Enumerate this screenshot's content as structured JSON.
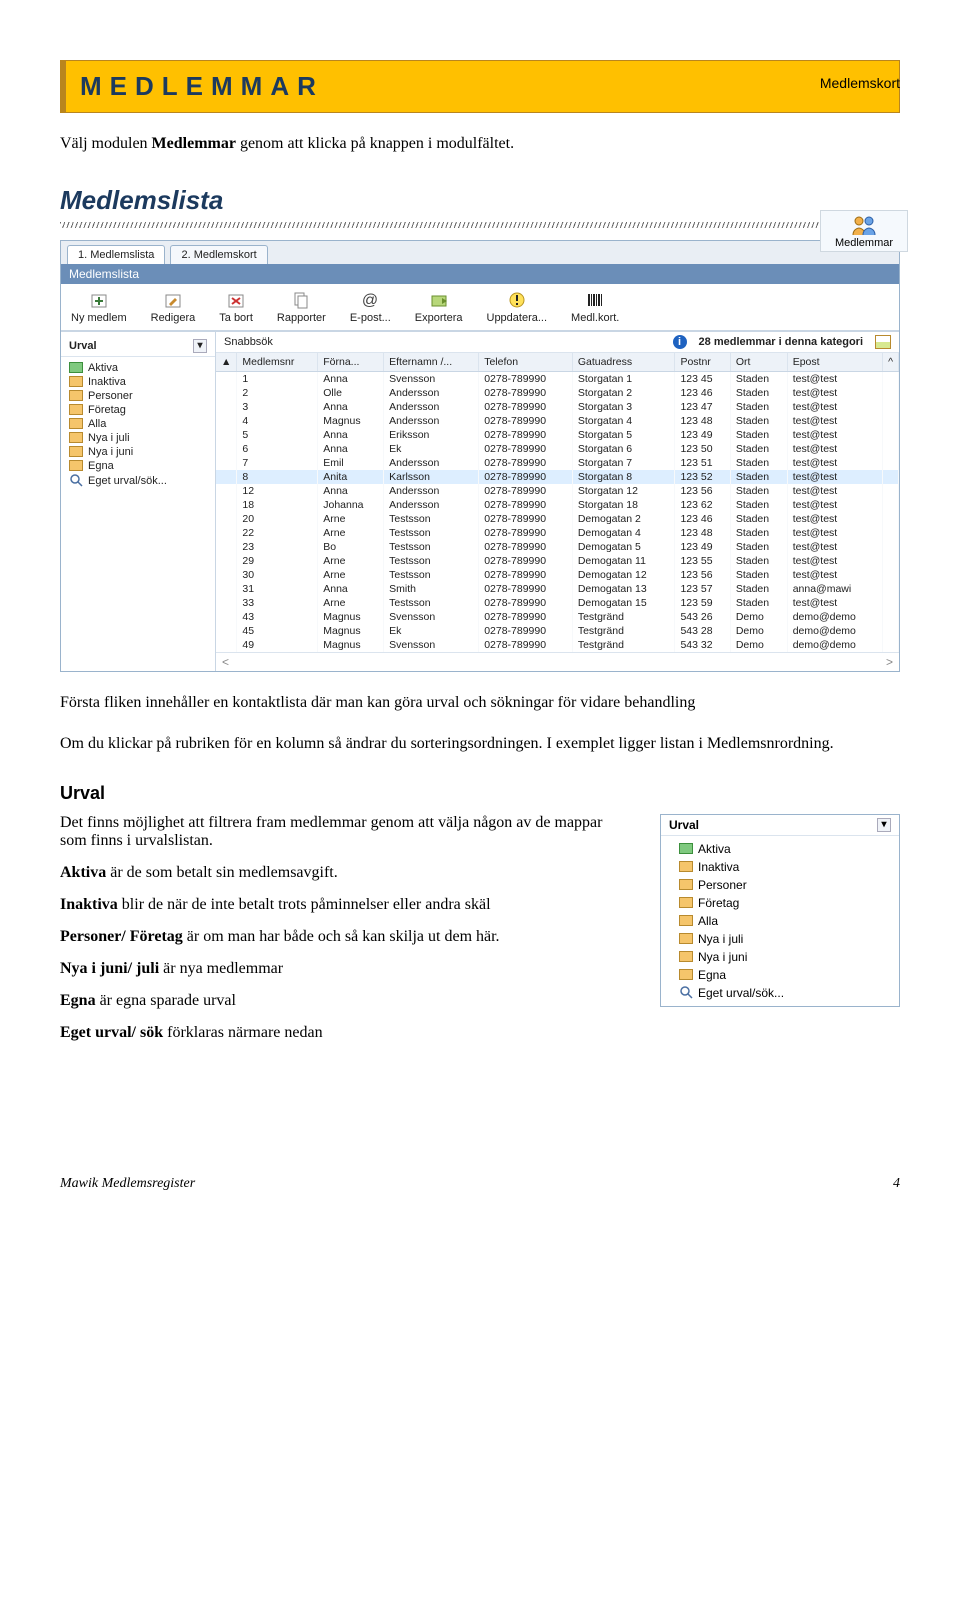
{
  "header_right": "Medlemskort",
  "title": "MEDLEMMAR",
  "intro": {
    "pre": "Välj modulen ",
    "bold": "Medlemmar",
    "post": " genom att klicka på knappen i modulfältet."
  },
  "module_icon_label": "Medlemmar",
  "section_medlemslista": "Medlemslista",
  "shot": {
    "tab1": "1. Medlemslista",
    "tab2": "2. Medlemskort",
    "bluebar": "Medlemslista",
    "toolbar": [
      "Ny medlem",
      "Redigera",
      "Ta bort",
      "Rapporter",
      "E-post...",
      "Exportera",
      "Uppdatera...",
      "Medl.kort."
    ],
    "urval_title": "Urval",
    "tree": [
      {
        "icon": "green",
        "label": "Aktiva"
      },
      {
        "icon": "folder",
        "label": "Inaktiva"
      },
      {
        "icon": "folder",
        "label": "Personer"
      },
      {
        "icon": "folder",
        "label": "Företag"
      },
      {
        "icon": "folder",
        "label": "Alla"
      },
      {
        "icon": "folder",
        "label": "Nya i juli"
      },
      {
        "icon": "folder",
        "label": "Nya i juni"
      },
      {
        "icon": "folder",
        "label": "Egna"
      },
      {
        "icon": "search",
        "label": "Eget urval/sök..."
      }
    ],
    "snabbsok": "Snabbsök",
    "count": "28 medlemmar i denna kategori",
    "columns": [
      "Medlemsnr",
      "Förna...",
      "Efternamn /...",
      "Telefon",
      "Gatuadress",
      "Postnr",
      "Ort",
      "Epost"
    ],
    "rows": [
      [
        "1",
        "Anna",
        "Svensson",
        "0278-789990",
        "Storgatan 1",
        "123 45",
        "Staden",
        "test@test"
      ],
      [
        "2",
        "Olle",
        "Andersson",
        "0278-789990",
        "Storgatan 2",
        "123 46",
        "Staden",
        "test@test"
      ],
      [
        "3",
        "Anna",
        "Andersson",
        "0278-789990",
        "Storgatan 3",
        "123 47",
        "Staden",
        "test@test"
      ],
      [
        "4",
        "Magnus",
        "Andersson",
        "0278-789990",
        "Storgatan 4",
        "123 48",
        "Staden",
        "test@test"
      ],
      [
        "5",
        "Anna",
        "Eriksson",
        "0278-789990",
        "Storgatan 5",
        "123 49",
        "Staden",
        "test@test"
      ],
      [
        "6",
        "Anna",
        "Ek",
        "0278-789990",
        "Storgatan 6",
        "123 50",
        "Staden",
        "test@test"
      ],
      [
        "7",
        "Emil",
        "Andersson",
        "0278-789990",
        "Storgatan 7",
        "123 51",
        "Staden",
        "test@test"
      ],
      [
        "8",
        "Anita",
        "Karlsson",
        "0278-789990",
        "Storgatan 8",
        "123 52",
        "Staden",
        "test@test"
      ],
      [
        "12",
        "Anna",
        "Andersson",
        "0278-789990",
        "Storgatan 12",
        "123 56",
        "Staden",
        "test@test"
      ],
      [
        "18",
        "Johanna",
        "Andersson",
        "0278-789990",
        "Storgatan 18",
        "123 62",
        "Staden",
        "test@test"
      ],
      [
        "20",
        "Arne",
        "Testsson",
        "0278-789990",
        "Demogatan 2",
        "123 46",
        "Staden",
        "test@test"
      ],
      [
        "22",
        "Arne",
        "Testsson",
        "0278-789990",
        "Demogatan 4",
        "123 48",
        "Staden",
        "test@test"
      ],
      [
        "23",
        "Bo",
        "Testsson",
        "0278-789990",
        "Demogatan 5",
        "123 49",
        "Staden",
        "test@test"
      ],
      [
        "29",
        "Arne",
        "Testsson",
        "0278-789990",
        "Demogatan 11",
        "123 55",
        "Staden",
        "test@test"
      ],
      [
        "30",
        "Arne",
        "Testsson",
        "0278-789990",
        "Demogatan 12",
        "123 56",
        "Staden",
        "test@test"
      ],
      [
        "31",
        "Anna",
        "Smith",
        "0278-789990",
        "Demogatan 13",
        "123 57",
        "Staden",
        "anna@mawi"
      ],
      [
        "33",
        "Arne",
        "Testsson",
        "0278-789990",
        "Demogatan 15",
        "123 59",
        "Staden",
        "test@test"
      ],
      [
        "43",
        "Magnus",
        "Svensson",
        "0278-789990",
        "Testgränd",
        "543 26",
        "Demo",
        "demo@demo"
      ],
      [
        "45",
        "Magnus",
        "Ek",
        "0278-789990",
        "Testgränd",
        "543 28",
        "Demo",
        "demo@demo"
      ],
      [
        "49",
        "Magnus",
        "Svensson",
        "0278-789990",
        "Testgränd",
        "543 32",
        "Demo",
        "demo@demo"
      ]
    ]
  },
  "para_after_shot1": "Första fliken innehåller en kontaktlista där man kan göra urval och sökningar för vidare behandling",
  "para_after_shot2": "Om du klickar på rubriken för en kolumn så ändrar du sorteringsordningen. I exemplet ligger listan i Medlemsnrordning.",
  "section_urval": "Urval",
  "urval_text": {
    "p1": "Det finns möjlighet att filtrera fram medlemmar genom att välja någon av de mappar som finns i urvalslistan.",
    "p2b": "Aktiva",
    "p2": " är de som betalt sin medlemsavgift.",
    "p3b": "Inaktiva",
    "p3": " blir de när de inte betalt trots påminnelser eller andra skäl",
    "p4b": "Personer/ Företag",
    "p4": " är om man har både och så kan skilja ut dem här.",
    "p5b": "Nya i juni/ juli",
    "p5": " är nya medlemmar",
    "p6b": "Egna",
    "p6": " är egna sparade urval",
    "p7b": "Eget urval/ sök",
    "p7": " förklaras närmare nedan"
  },
  "urval_panel_items": [
    "Aktiva",
    "Inaktiva",
    "Personer",
    "Företag",
    "Alla",
    "Nya i juli",
    "Nya i juni",
    "Egna",
    "Eget urval/sök..."
  ],
  "footer_left": "Mawik Medlemsregister",
  "footer_right": "4"
}
